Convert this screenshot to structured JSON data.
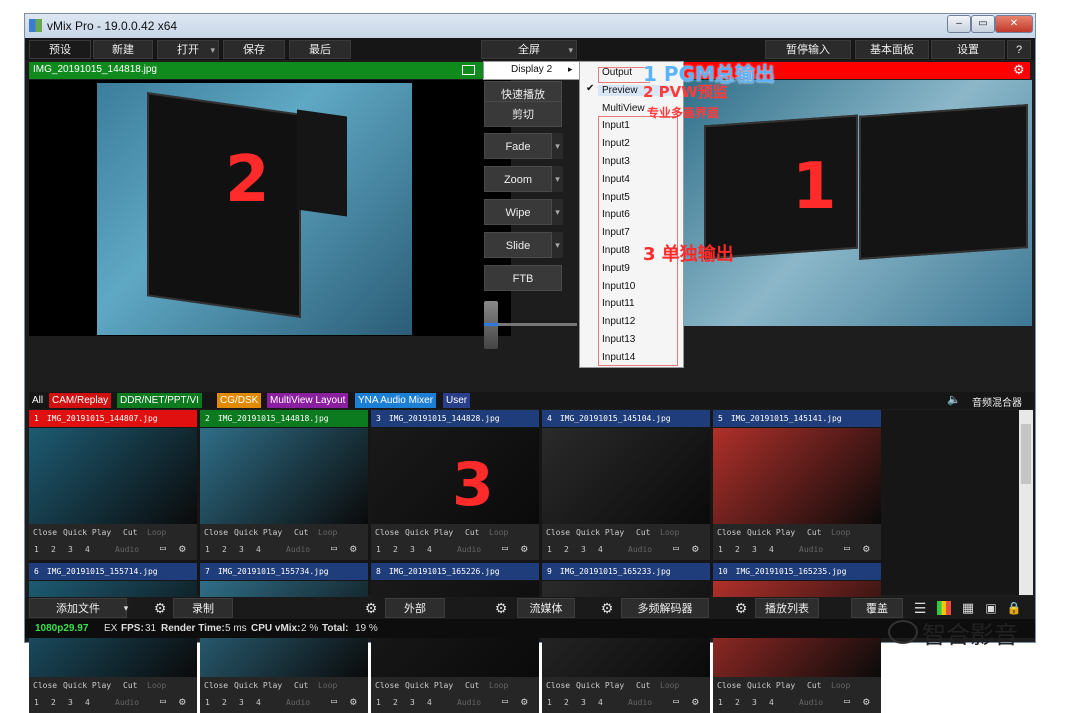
{
  "window": {
    "title": "vMix Pro - 19.0.0.42 x64"
  },
  "toolbar": {
    "preset": "预设",
    "new": "新建",
    "open": "打开",
    "save": "保存",
    "recent": "最后",
    "fullscreen": "全屏",
    "pause_input": "暂停输入",
    "basic_panel": "基本面板",
    "settings": "设置",
    "help": "?"
  },
  "preview": {
    "filename": "IMG_20191015_144818.jpg"
  },
  "transitions": {
    "quick_play": "快速播放",
    "cut": "剪切",
    "fade": "Fade",
    "zoom": "Zoom",
    "wipe": "Wipe",
    "slide": "Slide",
    "ftb": "FTB"
  },
  "menu": {
    "display": "Display 2",
    "items": [
      "Output",
      "Preview",
      "MultiView",
      "Input1",
      "Input2",
      "Input3",
      "Input4",
      "Input5",
      "Input6",
      "Input7",
      "Input8",
      "Input9",
      "Input10",
      "Input11",
      "Input12",
      "Input13",
      "Input14"
    ]
  },
  "annotations": {
    "pgm": "1  PGM总输出",
    "pvw": "2  PVW预监",
    "multiview": "专业多画界面",
    "single": "3  单独输出",
    "big1": "1",
    "big2": "2",
    "big3": "3"
  },
  "tabs": [
    {
      "label": "All",
      "color": "#161616"
    },
    {
      "label": "CAM/Replay",
      "color": "#d01010"
    },
    {
      "label": "DDR/NET/PPT/VI",
      "color": "#0c7a1e"
    },
    {
      "label": "CG/DSK",
      "color": "#e08a00"
    },
    {
      "label": "MultiView Layout",
      "color": "#8a1fa0"
    },
    {
      "label": "YNA Audio Mixer",
      "color": "#1c7fd6"
    },
    {
      "label": "User",
      "color": "#2a3f8a"
    }
  ],
  "audio_mixer": "音频混合器",
  "inputs": [
    {
      "num": "1",
      "name": "IMG_20191015_144807.jpg",
      "color": "#e01010"
    },
    {
      "num": "2",
      "name": "IMG_20191015_144818.jpg",
      "color": "#0c7a1e"
    },
    {
      "num": "3",
      "name": "IMG_20191015_144828.jpg",
      "color": "#1f3d7a"
    },
    {
      "num": "4",
      "name": "IMG_20191015_145104.jpg",
      "color": "#1f3d7a"
    },
    {
      "num": "5",
      "name": "IMG_20191015_145141.jpg",
      "color": "#1f3d7a"
    },
    {
      "num": "6",
      "name": "IMG_20191015_155714.jpg",
      "color": "#1f3d7a"
    },
    {
      "num": "7",
      "name": "IMG_20191015_155734.jpg",
      "color": "#1f3d7a"
    },
    {
      "num": "8",
      "name": "IMG_20191015_165226.jpg",
      "color": "#1f3d7a"
    },
    {
      "num": "9",
      "name": "IMG_20191015_165233.jpg",
      "color": "#1f3d7a"
    },
    {
      "num": "10",
      "name": "IMG_20191015_165235.jpg",
      "color": "#1f3d7a"
    }
  ],
  "tile_controls": {
    "close": "Close",
    "quick_play": "Quick Play",
    "cut": "Cut",
    "loop": "Loop",
    "audio": "Audio",
    "nums": [
      "1",
      "2",
      "3",
      "4"
    ]
  },
  "bottom": {
    "add_input": "添加文件",
    "record": "录制",
    "external": "外部",
    "stream": "流媒体",
    "multicorder": "多频解码器",
    "playlist": "播放列表",
    "overlay": "覆盖"
  },
  "status": {
    "format": "1080p29.97",
    "ex": "EX",
    "fps_label": "FPS:",
    "fps": "31",
    "render_label": "Render Time:",
    "render": "5 ms",
    "cpu_label": "CPU vMix:",
    "cpu": "2 %",
    "total_label": "Total:",
    "total": "19 %"
  },
  "watermark": "智合影音"
}
